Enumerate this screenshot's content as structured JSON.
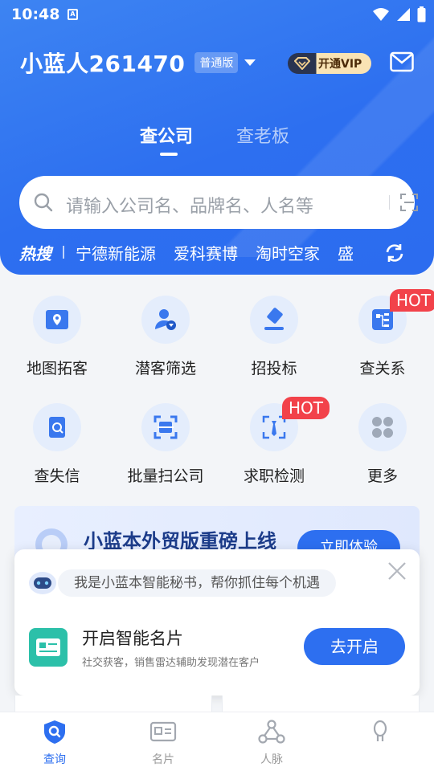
{
  "status_bar": {
    "time": "10:48",
    "app_icon_letter": "A"
  },
  "header": {
    "username": "小蓝人261470",
    "edition_badge": "普通版",
    "vip_button_label": "开通VIP",
    "tabs": [
      {
        "label": "查公司",
        "active": true
      },
      {
        "label": "查老板",
        "active": false
      }
    ],
    "search_placeholder": "请输入公司名、品牌名、人名等",
    "hot_search_label": "热搜",
    "hot_items": [
      "宁德新能源",
      "爱科赛博",
      "淘时空家",
      "盛"
    ],
    "accent_color": "#2d6ff0"
  },
  "grid": {
    "items": [
      {
        "label": "地图拓客",
        "icon": "map-pin-icon"
      },
      {
        "label": "潜客筛选",
        "icon": "user-filter-icon"
      },
      {
        "label": "招投标",
        "icon": "gavel-icon"
      },
      {
        "label": "查关系",
        "icon": "relation-chart-icon",
        "badge": "HOT"
      },
      {
        "label": "查失信",
        "icon": "dishonest-search-icon"
      },
      {
        "label": "批量扫公司",
        "icon": "scan-batch-icon"
      },
      {
        "label": "求职检测",
        "icon": "job-check-icon",
        "badge": "HOT"
      },
      {
        "label": "更多",
        "icon": "more-dots-icon"
      }
    ],
    "badge_color": "#f2424a"
  },
  "banner": {
    "title": "小蓝本外贸版重磅上线",
    "button_label": "立即体验"
  },
  "popup": {
    "assistant_message": "我是小蓝本智能秘书，帮你抓住每个机遇",
    "card_title": "开启智能名片",
    "card_subtitle": "社交获客，销售雷达辅助发现潜在客户",
    "button_label": "去开启"
  },
  "bottom_nav": {
    "items": [
      {
        "label": "查询",
        "icon": "search-shield-icon",
        "active": true
      },
      {
        "label": "名片",
        "icon": "id-card-icon",
        "active": false
      },
      {
        "label": "人脉",
        "icon": "network-icon",
        "active": false
      },
      {
        "label": "",
        "icon": "profile-icon",
        "active": false
      }
    ]
  }
}
